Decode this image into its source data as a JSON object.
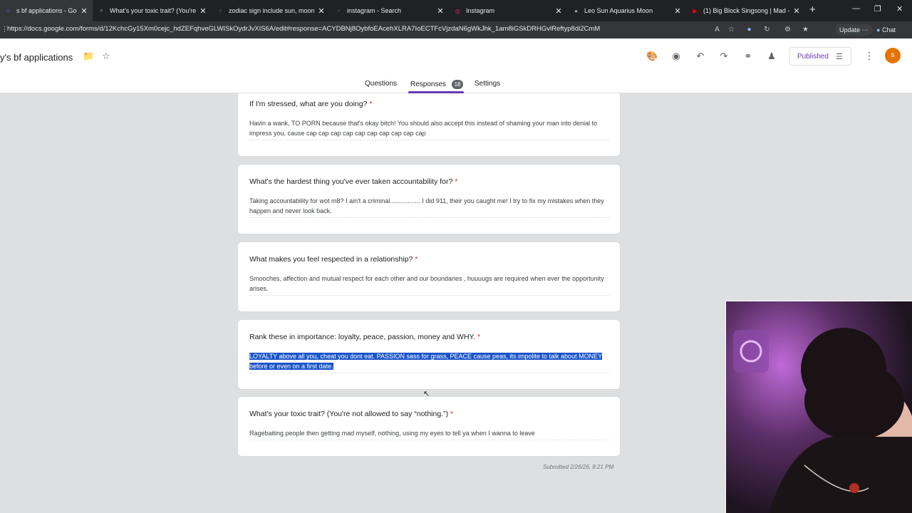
{
  "browser": {
    "tabs": [
      {
        "title": "s bf applications - Google Fo",
        "fav": "forms",
        "color": "#673ab7",
        "active": true
      },
      {
        "title": "What's your toxic trait? (You're no",
        "fav": "search",
        "color": "#8ab4f8",
        "active": false
      },
      {
        "title": "zodiac sign include sun, moon, All",
        "fav": "search",
        "color": "#5f6368",
        "active": false
      },
      {
        "title": "instagram - Search",
        "fav": "search",
        "color": "#5f6368",
        "active": false
      },
      {
        "title": "Instagram",
        "fav": "instagram",
        "color": "#e1306c",
        "active": false
      },
      {
        "title": "Leo Sun Aquarius Moon",
        "fav": "web",
        "color": "#9aa0a6",
        "active": false
      },
      {
        "title": "(1) Big Block Singsong | Mad - Yo",
        "fav": "youtube",
        "color": "#ff0000",
        "active": false
      }
    ],
    "url": "https://docs.google.com/forms/d/12KchcGy15Xm0cejc_hdZEFqhveGLWISkOydrJvXIS6A/edit#response=ACYDBNj8OybfoEAcehXLRA7IoECTFcVjzdaN6gWkJhk_1am8iGSkDRHGvlReftyp8di2CmM",
    "update_label": "Update",
    "chat_label": "Chat"
  },
  "form": {
    "title": "y's bf applications",
    "published_label": "Published",
    "user_initial": "s",
    "tabs": {
      "questions": "Questions",
      "responses": "Responses",
      "responses_count": "18",
      "settings": "Settings"
    }
  },
  "responses": [
    {
      "question": "If I'm stressed, what are you doing?",
      "required": "*",
      "answer": "Havin a wank, TO PORN because that's okay bitch! You should also accept this instead of shaming your man into denial to impress you, cause cap cap cap cap cap cap cap cap cap cap",
      "selected": false
    },
    {
      "question": "What's the hardest thing you've ever taken accountability for?",
      "required": "*",
      "answer": "Taking accountability for wot m8? I ain't a criminal................. I did 911, their you caught me! I try to fix my mistakes when they happen and never look back.",
      "selected": false
    },
    {
      "question": "What makes you feel respected in a relationship?",
      "required": "*",
      "answer": "Smooches, affection and mutual respect for each other and our boundaries , huuuugs are required when ever the opportunity arises.",
      "selected": false
    },
    {
      "question": "Rank these in importance: loyalty, peace, passion, money and WHY.",
      "required": "*",
      "answer": "LOYALTY above all you, cheat you dont eat. PASSION sass for grass, PEACE cause peas, its impolite to talk about MONEY before or even on a first date.",
      "selected": true
    },
    {
      "question": "What's your toxic trait? (You're not allowed to say “nothing.”)",
      "required": "*",
      "answer": "Ragebaiting people then getting mad myself, nothing, using my eyes to tell ya when I wanna to leave",
      "selected": false
    }
  ],
  "submitted": "Submitted 2/26/26, 8:21 PM"
}
